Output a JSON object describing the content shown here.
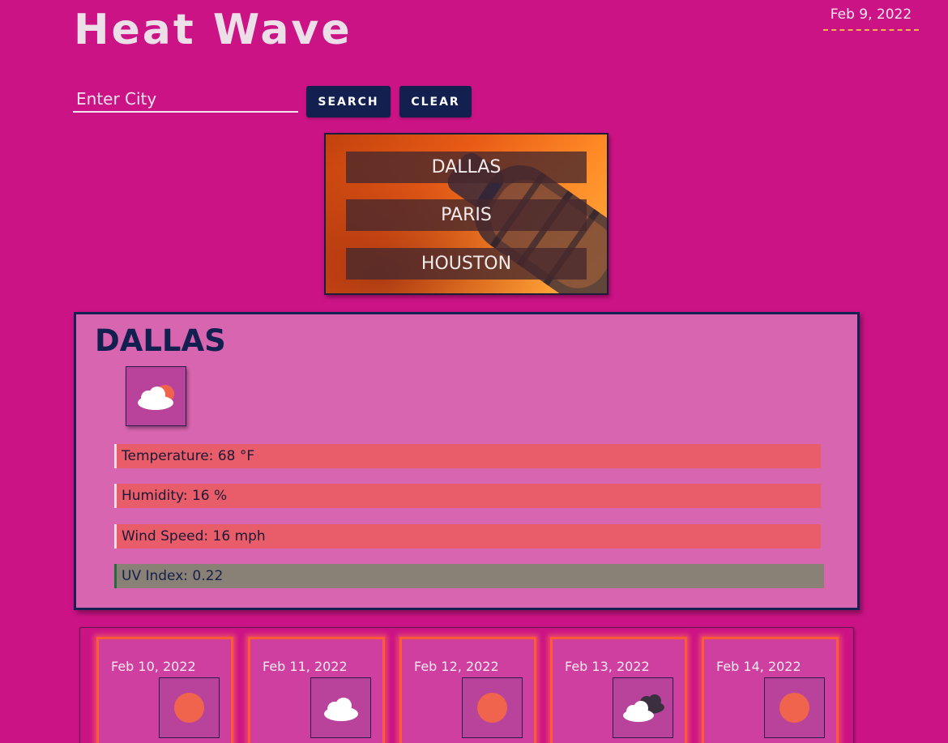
{
  "app": {
    "title": "Heat Wave",
    "date": "Feb 9, 2022"
  },
  "search": {
    "placeholder": "Enter City",
    "value": "",
    "search_label": "SEARCH",
    "clear_label": "CLEAR"
  },
  "history": [
    {
      "label": "DALLAS"
    },
    {
      "label": "PARIS"
    },
    {
      "label": "HOUSTON"
    }
  ],
  "current": {
    "city": "DALLAS",
    "icon": "partly-cloudy-icon",
    "temperature": "Temperature: 68 °F",
    "humidity": "Humidity: 16 %",
    "wind": "Wind Speed: 16 mph",
    "uv": "UV Index: 0.22"
  },
  "forecast": [
    {
      "date": "Feb 10, 2022",
      "icon": "sun-icon"
    },
    {
      "date": "Feb 11, 2022",
      "icon": "cloud-icon"
    },
    {
      "date": "Feb 12, 2022",
      "icon": "sun-icon"
    },
    {
      "date": "Feb 13, 2022",
      "icon": "broken-clouds-icon"
    },
    {
      "date": "Feb 14, 2022",
      "icon": "sun-icon"
    }
  ],
  "colors": {
    "background": "#cc1386",
    "button": "#13204f",
    "stat_bar": "#e85d69",
    "uv_bar": "#8a8176",
    "forecast_border": "#ff5a35"
  }
}
